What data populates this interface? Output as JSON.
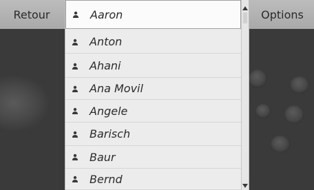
{
  "header": {
    "back_label": "Retour",
    "options_label": "Options"
  },
  "contacts": [
    {
      "name": "Aaron",
      "selected": true
    },
    {
      "name": "Anton",
      "selected": false
    },
    {
      "name": "Ahani",
      "selected": false
    },
    {
      "name": "Ana Movil",
      "selected": false
    },
    {
      "name": "Angele",
      "selected": false
    },
    {
      "name": "Barisch",
      "selected": false
    },
    {
      "name": "Baur",
      "selected": false
    },
    {
      "name": "Bernd",
      "selected": false
    }
  ],
  "icons": {
    "row_icon": "person-icon",
    "scroll_up": "triangle-up-icon",
    "scroll_down": "triangle-down-icon"
  },
  "colors": {
    "header_bg": "#b4b4b4",
    "list_bg": "#ececec",
    "text": "#2b2b2b"
  }
}
